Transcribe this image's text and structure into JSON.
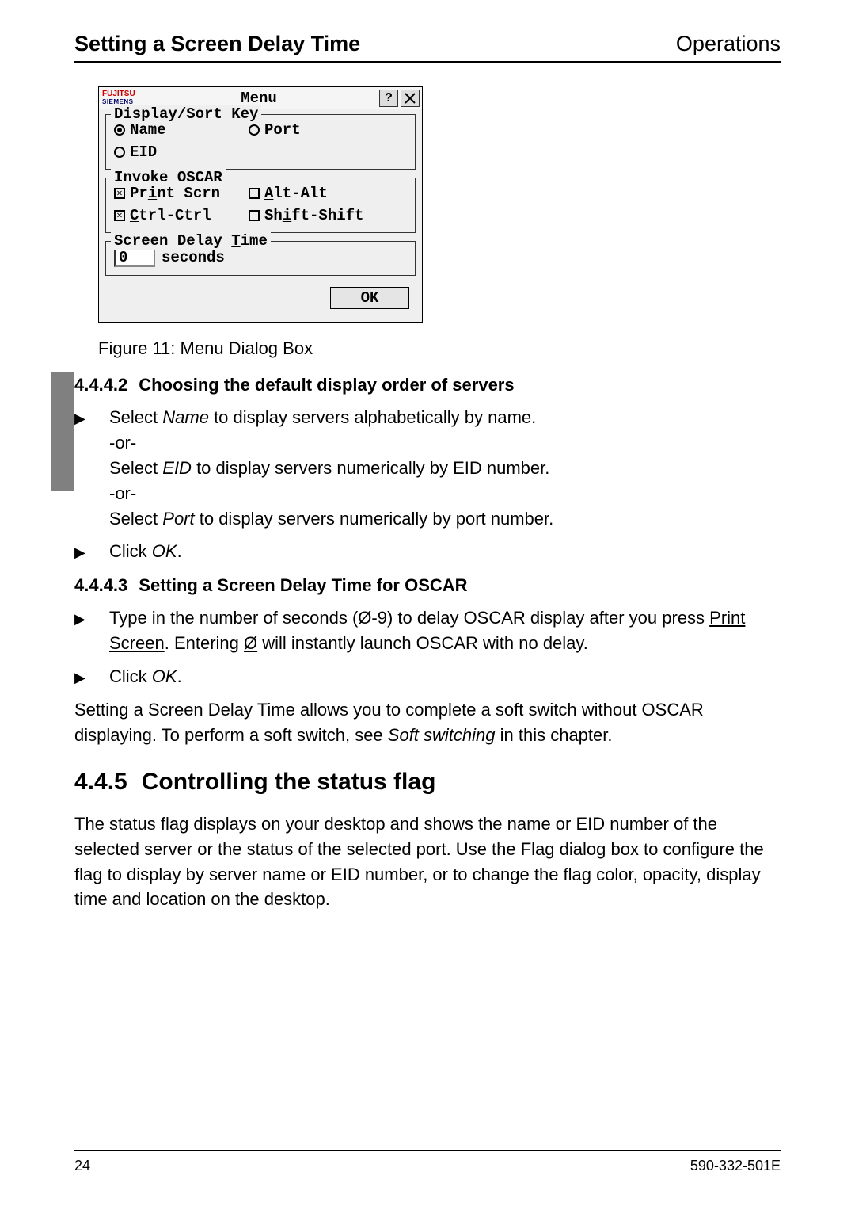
{
  "header": {
    "left": "Setting a Screen Delay Time",
    "right": "Operations"
  },
  "dialog": {
    "brand_top": "FUJITSU",
    "brand_sub": "SIEMENS",
    "title": "Menu",
    "help_label": "?",
    "group1": {
      "legend": "Display/Sort Key",
      "name_pre": "N",
      "name_rest": "ame",
      "port_pre": "P",
      "port_rest": "ort",
      "eid_pre": "E",
      "eid_rest": "ID"
    },
    "group2": {
      "legend": "Invoke OSCAR",
      "print_pre": "Pr",
      "print_mid": "i",
      "print_rest": "nt Scrn",
      "alt_pre": "A",
      "alt_rest": "lt-Alt",
      "ctrl_pre": "C",
      "ctrl_rest": "trl-Ctrl",
      "shift_pre": "Sh",
      "shift_mid": "i",
      "shift_rest": "ft-Shift"
    },
    "group3": {
      "legend_pre": "Screen Delay ",
      "legend_key": "T",
      "legend_rest": "ime",
      "value": "0",
      "unit": "seconds"
    },
    "ok_pre": "O",
    "ok_rest": "K"
  },
  "figure_caption": "Figure 11: Menu Dialog Box",
  "sec442": {
    "num": "4.4.4.2",
    "title": "Choosing the default display order of servers",
    "step1a": "Select ",
    "step1a_i": "Name",
    "step1a_end": " to display servers alphabetically by name.",
    "or": "-or-",
    "step1b": "Select ",
    "step1b_i": "EID",
    "step1b_end": " to display servers numerically by EID number.",
    "step1c": "Select ",
    "step1c_i": "Port",
    "step1c_end": " to display servers numerically by port number.",
    "step2a": "Click ",
    "step2a_i": "OK",
    "step2a_end": "."
  },
  "sec443": {
    "num": "4.4.4.3",
    "title": "Setting a Screen Delay Time for OSCAR",
    "step1a": "Type in the number of seconds (Ø-9) to delay OSCAR display after you press ",
    "step1_u": "Print Screen",
    "step1b": ". Entering ",
    "step1_u2": "Ø",
    "step1c": " will instantly launch OSCAR with no delay.",
    "step2a": "Click ",
    "step2a_i": "OK",
    "step2a_end": "."
  },
  "para_soft": {
    "a": "Setting a Screen Delay Time allows you to complete a soft switch without OSCAR displaying. To perform a soft switch, see ",
    "i": "Soft switching",
    "b": " in this chapter."
  },
  "sec445": {
    "num": "4.4.5",
    "title": "Controlling the status flag",
    "para": "The status flag displays on your desktop and shows the name or EID number of the selected server or the status of the selected port. Use the Flag dialog box to configure the flag to display by server name or EID number, or to change the flag color, opacity, display time and location on the desktop."
  },
  "footer": {
    "page": "24",
    "doc": "590-332-501E"
  }
}
